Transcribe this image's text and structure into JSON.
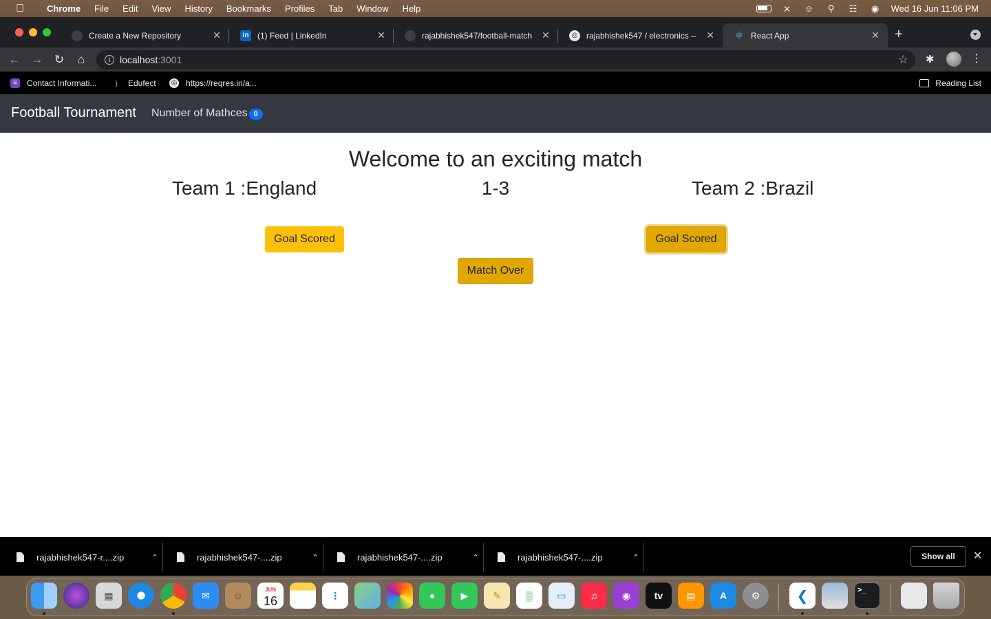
{
  "menubar": {
    "app": "Chrome",
    "items": [
      "File",
      "Edit",
      "View",
      "History",
      "Bookmarks",
      "Profiles",
      "Tab",
      "Window",
      "Help"
    ],
    "datetime": "Wed 16 Jun  11:06 PM"
  },
  "tabs": [
    {
      "title": "Create a New Repository",
      "favicon": "github-icon"
    },
    {
      "title": "(1) Feed | LinkedIn",
      "favicon": "linkedin-icon"
    },
    {
      "title": "rajabhishek547/football-match",
      "favicon": "github-icon"
    },
    {
      "title": "rajabhishek547 / electronics –",
      "favicon": "globe-icon"
    },
    {
      "title": "React App",
      "favicon": "react-icon",
      "active": true
    }
  ],
  "address": {
    "host": "localhost",
    "port": ":3001"
  },
  "bookmarks": [
    {
      "label": "Contact Informati...",
      "icon": "form-icon"
    },
    {
      "label": "Edufect",
      "icon": "info-icon"
    },
    {
      "label": "https://reqres.in/a...",
      "icon": "globe-icon"
    }
  ],
  "reading_list": "Reading List",
  "app": {
    "brand": "Football Tournament",
    "matches_label": "Number of Mathces",
    "matches_count": "0",
    "heading": "Welcome to an exciting match",
    "team1": "Team 1 :England",
    "team2": "Team 2 :Brazil",
    "score": "1-3",
    "goal_button": "Goal Scored",
    "match_over_button": "Match Over"
  },
  "downloads": {
    "items": [
      "rajabhishek547-r....zip",
      "rajabhishek547-....zip",
      "rajabhishek547-....zip",
      "rajabhishek547-....zip"
    ],
    "show_all": "Show all"
  },
  "dock": {
    "tv_label": "tv",
    "calendar_month": "JUN",
    "calendar_day": "16"
  }
}
